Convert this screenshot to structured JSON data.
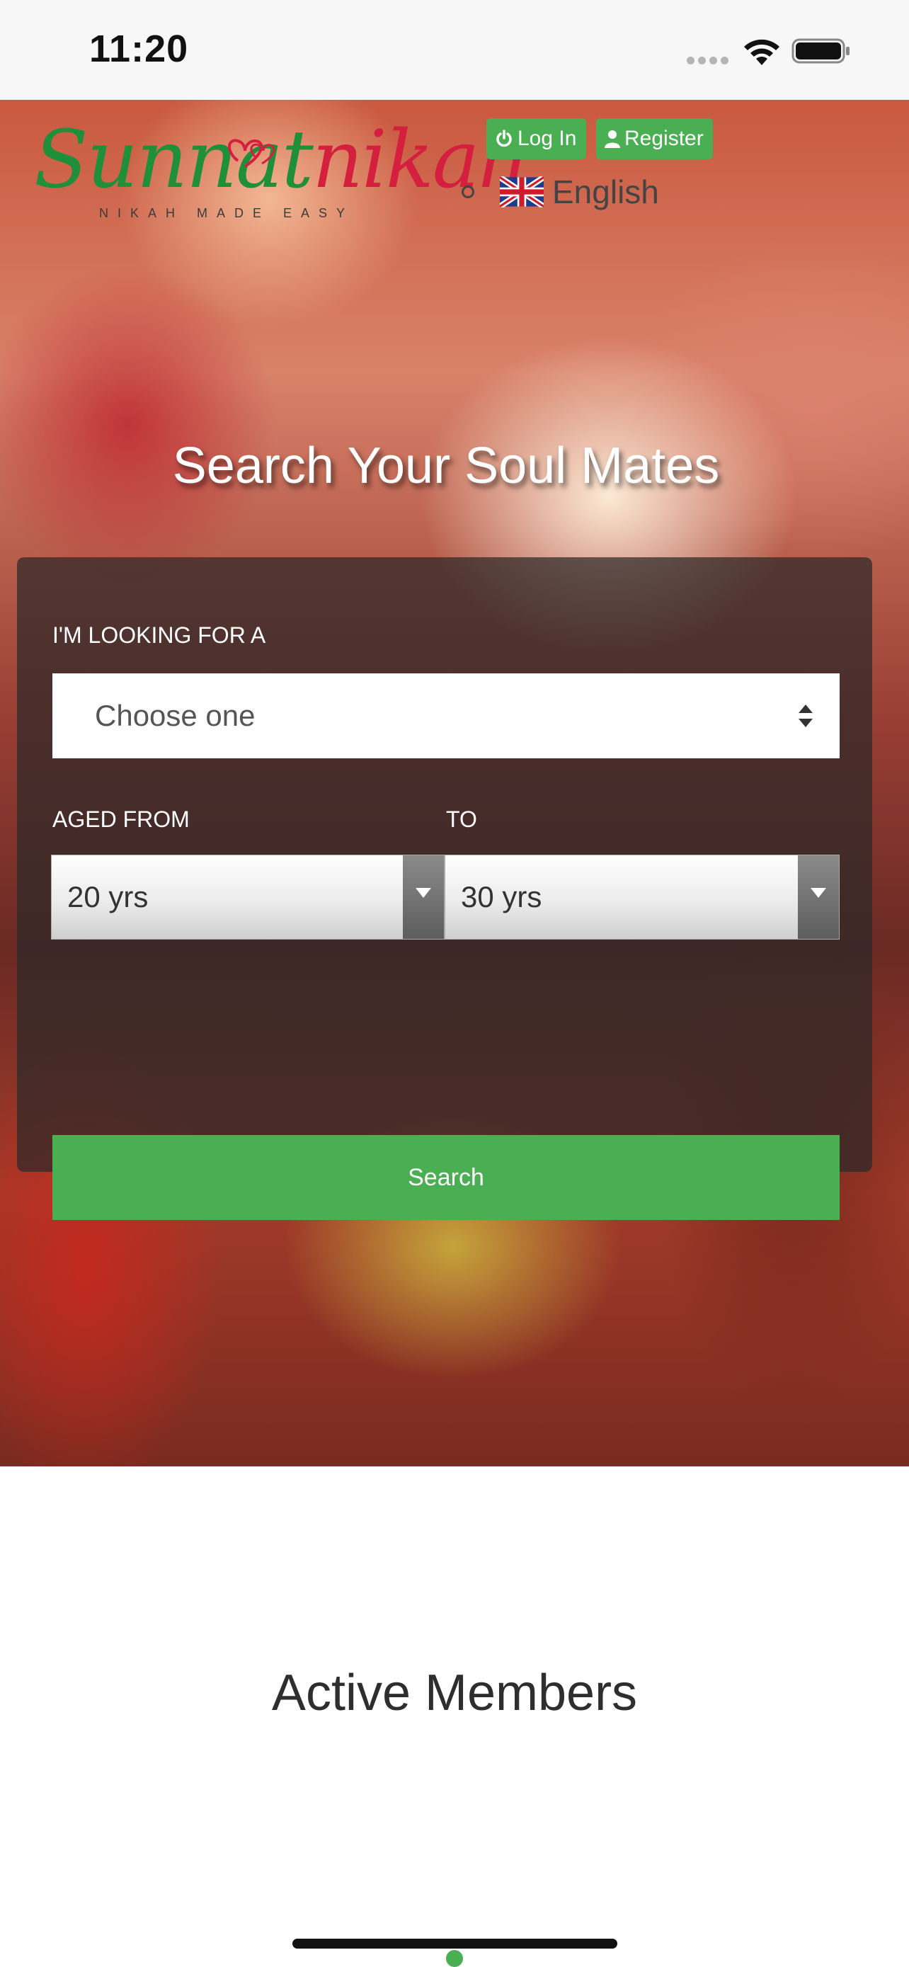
{
  "status_bar": {
    "time": "11:20"
  },
  "header": {
    "logo": {
      "text_green": "Sunnat",
      "text_red": "nikah",
      "tagline": "NIKAH MADE EASY"
    },
    "login_label": "Log In",
    "register_label": "Register",
    "language_label": "English"
  },
  "hero": {
    "title": "Search Your Soul Mates"
  },
  "search_form": {
    "looking_for_label": "I'M LOOKING FOR A",
    "looking_for_value": "Choose one",
    "aged_from_label": "AGED FROM",
    "to_label": "TO",
    "age_from_value": "20 yrs",
    "age_to_value": "30 yrs",
    "search_label": "Search"
  },
  "members": {
    "title": "Active Members"
  },
  "colors": {
    "accent_green": "#4aae52",
    "logo_red": "#d51f3f",
    "logo_green": "#1f8f3a"
  }
}
